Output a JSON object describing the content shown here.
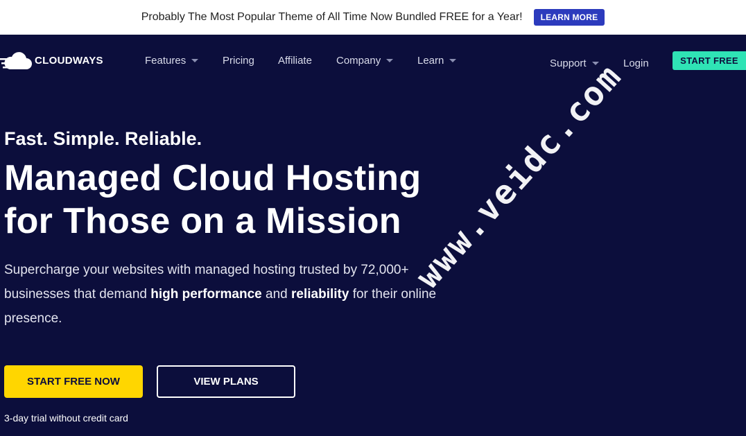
{
  "promo": {
    "text": "Probably The Most Popular Theme of All Time Now Bundled FREE for a Year!",
    "button": "LEARN MORE"
  },
  "nav": {
    "logo": "CLOUDWAYS",
    "items": [
      {
        "label": "Features",
        "dropdown": true
      },
      {
        "label": "Pricing",
        "dropdown": false
      },
      {
        "label": "Affiliate",
        "dropdown": false
      },
      {
        "label": "Company",
        "dropdown": true
      },
      {
        "label": "Learn",
        "dropdown": true
      }
    ],
    "support": "Support",
    "login": "Login",
    "start_free": "START FREE"
  },
  "hero": {
    "tagline": "Fast. Simple. Reliable.",
    "headline_line1": "Managed Cloud Hosting",
    "headline_line2": "for Those on a Mission",
    "desc_part1": "Supercharge your websites with managed hosting trusted by 72,000+ businesses that demand ",
    "desc_bold1": "high performance",
    "desc_part2": " and ",
    "desc_bold2": "reliability",
    "desc_part3": " for their online presence.",
    "primary_button": "START FREE NOW",
    "secondary_button": "VIEW PLANS",
    "trial_note": "3-day trial without credit card"
  },
  "watermark": "www.veidc.com",
  "colors": {
    "background": "#0c0e3c",
    "accent_green": "#2fe3b5",
    "accent_yellow": "#ffd600",
    "promo_button": "#2c3bbd"
  }
}
